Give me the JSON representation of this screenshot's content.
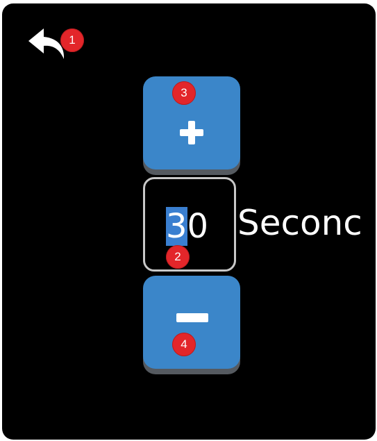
{
  "toolbar": {
    "back_icon": "undo-arrow-icon"
  },
  "stepper": {
    "increment_icon": "plus-icon",
    "decrement_icon": "minus-icon",
    "value_selected_part": "3",
    "value_rest": "0",
    "unit_label": "Seconc"
  },
  "markers": [
    "1",
    "2",
    "3",
    "4"
  ],
  "colors": {
    "background": "#000000",
    "button": "#3b86c9",
    "marker": "#e3262a",
    "selection": "#3a7fd0"
  }
}
